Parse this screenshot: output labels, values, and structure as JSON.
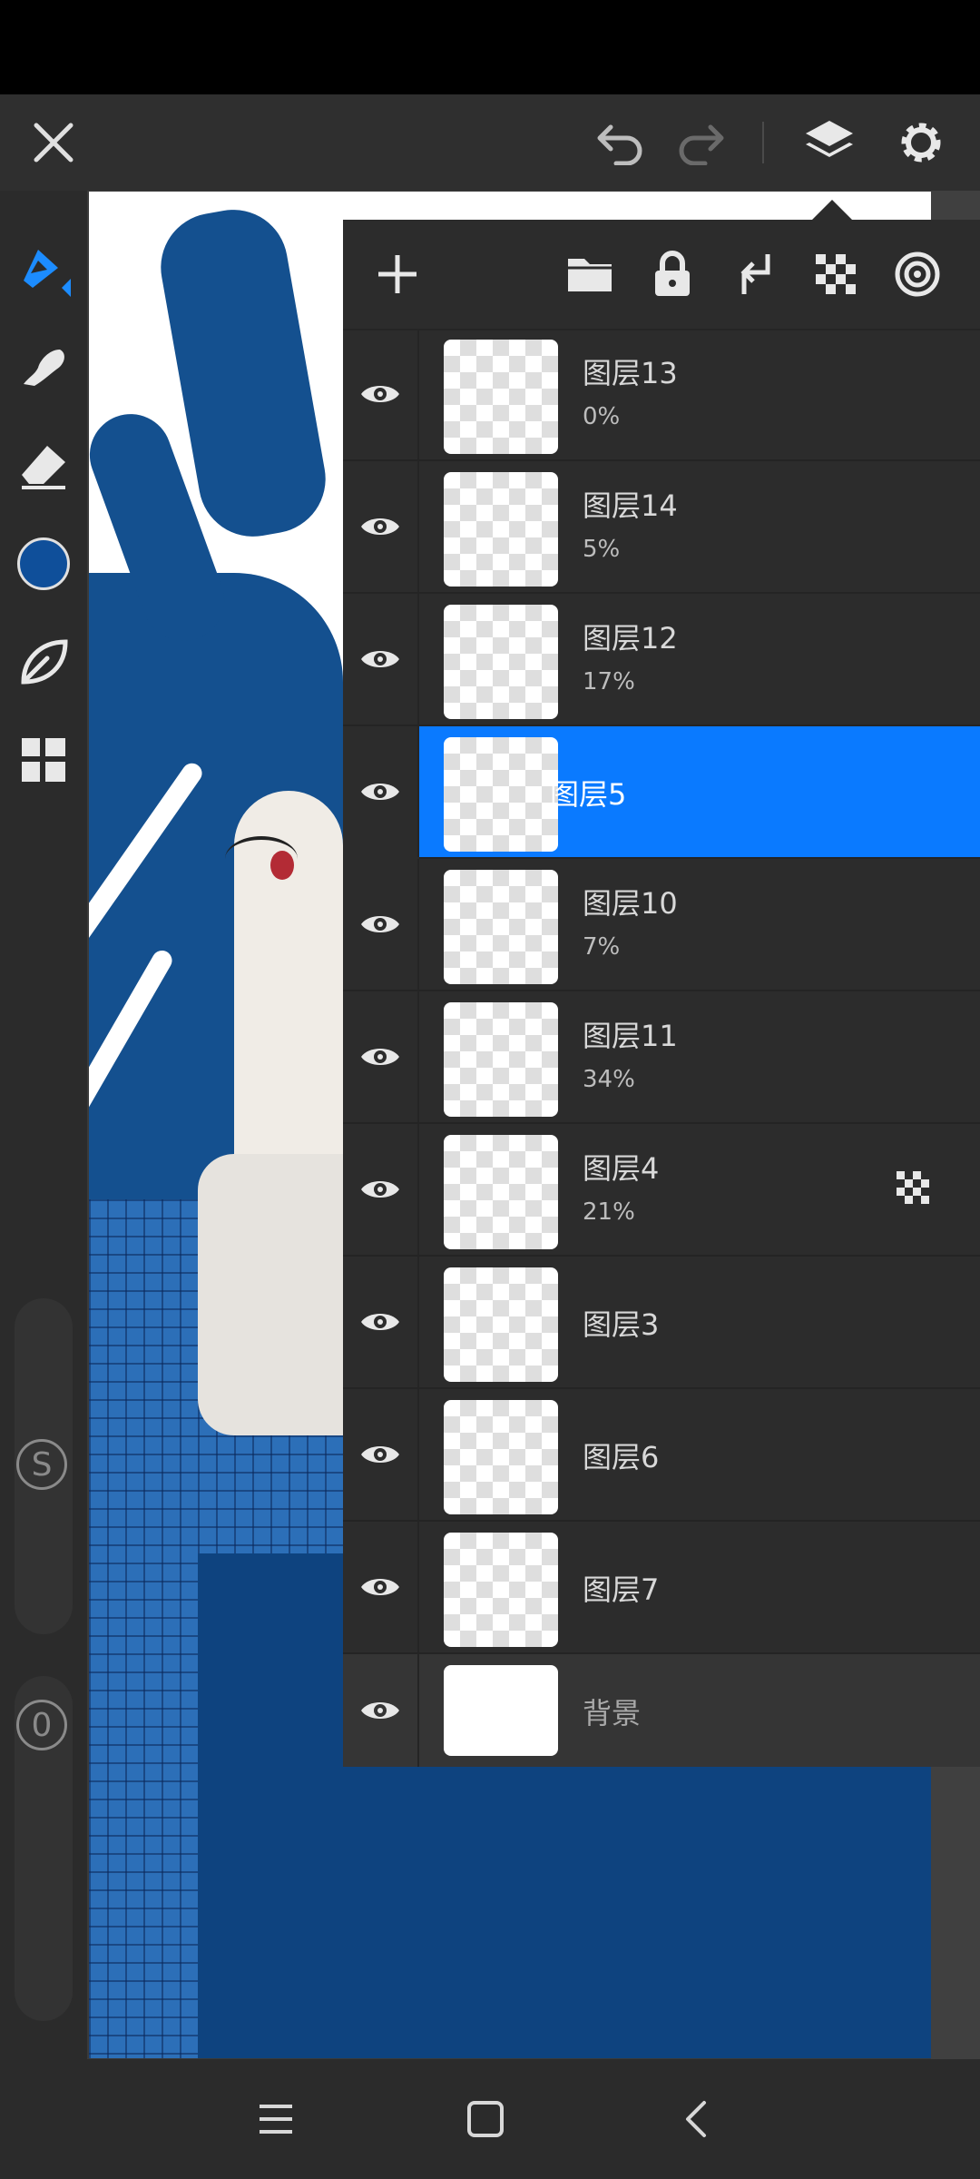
{
  "layers": [
    {
      "name": "图层13",
      "opacity": "0%"
    },
    {
      "name": "图层14",
      "opacity": "5%"
    },
    {
      "name": "图层12",
      "opacity": "17%"
    },
    {
      "name": "图层5",
      "opacity": ""
    },
    {
      "name": "图层10",
      "opacity": "7%"
    },
    {
      "name": "图层11",
      "opacity": "34%"
    },
    {
      "name": "图层4",
      "opacity": "21%"
    },
    {
      "name": "图层3",
      "opacity": ""
    },
    {
      "name": "图层6",
      "opacity": ""
    },
    {
      "name": "图层7",
      "opacity": ""
    },
    {
      "name": "背景",
      "opacity": ""
    }
  ],
  "selected_layer": "图层5",
  "sliders": {
    "size_label": "S",
    "opacity_label": "0"
  },
  "colors": {
    "accent": "#0a7aff",
    "current_color": "#0f4f9a"
  },
  "icons": {
    "top_bar": [
      "close-icon",
      "undo-icon",
      "redo-icon",
      "layers-icon",
      "settings-icon"
    ],
    "left_bar": [
      "brush-icon",
      "smudge-icon",
      "eraser-icon",
      "color-swatch",
      "leaf-icon",
      "grid-icon"
    ],
    "panel": [
      "add-layer-icon",
      "folder-icon",
      "lock-icon",
      "merge-down-icon",
      "transparency-icon",
      "target-icon"
    ],
    "nav": [
      "menu-icon",
      "home-icon",
      "back-icon"
    ]
  }
}
